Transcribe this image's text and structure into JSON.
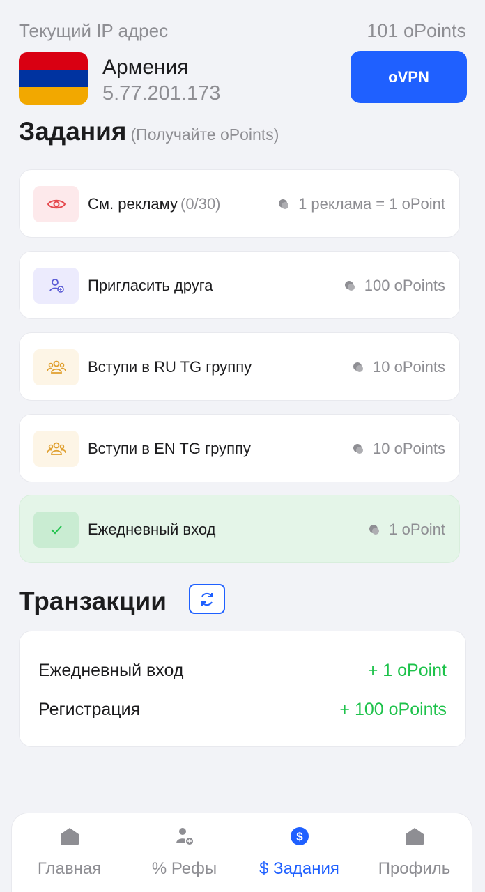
{
  "header": {
    "current_ip_label": "Текущий IP адрес",
    "points": "101 oPoints",
    "country": "Армения",
    "ip": "5.77.201.173",
    "vpn_button": "oVPN"
  },
  "tasks_section": {
    "title": "Задания",
    "subtitle": "(Получайте oPoints)",
    "items": [
      {
        "label": "См. рекламу",
        "count": "(0/30)",
        "reward": "1 реклама = 1 oPoint",
        "icon": "eye-icon",
        "done": false
      },
      {
        "label": "Пригласить друга",
        "count": "",
        "reward": "100 oPoints",
        "icon": "user-add-icon",
        "done": false
      },
      {
        "label": "Вступи в RU TG группу",
        "count": "",
        "reward": "10 oPoints",
        "icon": "group-icon",
        "done": false
      },
      {
        "label": "Вступи в EN TG группу",
        "count": "",
        "reward": "10 oPoints",
        "icon": "group-icon",
        "done": false
      },
      {
        "label": "Ежедневный вход",
        "count": "",
        "reward": "1 oPoint",
        "icon": "check-icon",
        "done": true
      }
    ]
  },
  "transactions": {
    "title": "Транзакции",
    "items": [
      {
        "name": "Ежедневный вход",
        "amount": "+ 1 oPoint"
      },
      {
        "name": "Регистрация",
        "amount": "+ 100 oPoints"
      }
    ]
  },
  "nav": {
    "items": [
      {
        "label": "Главная",
        "icon": "home-icon",
        "active": false
      },
      {
        "label": "% Рефы",
        "icon": "referral-icon",
        "active": false
      },
      {
        "label": "$ Задания",
        "icon": "dollar-icon",
        "active": true
      },
      {
        "label": "Профиль",
        "icon": "profile-icon",
        "active": false
      }
    ]
  },
  "colors": {
    "accent": "#1f60ff",
    "success": "#1ec24b",
    "done_bg": "#e4f5e8"
  }
}
